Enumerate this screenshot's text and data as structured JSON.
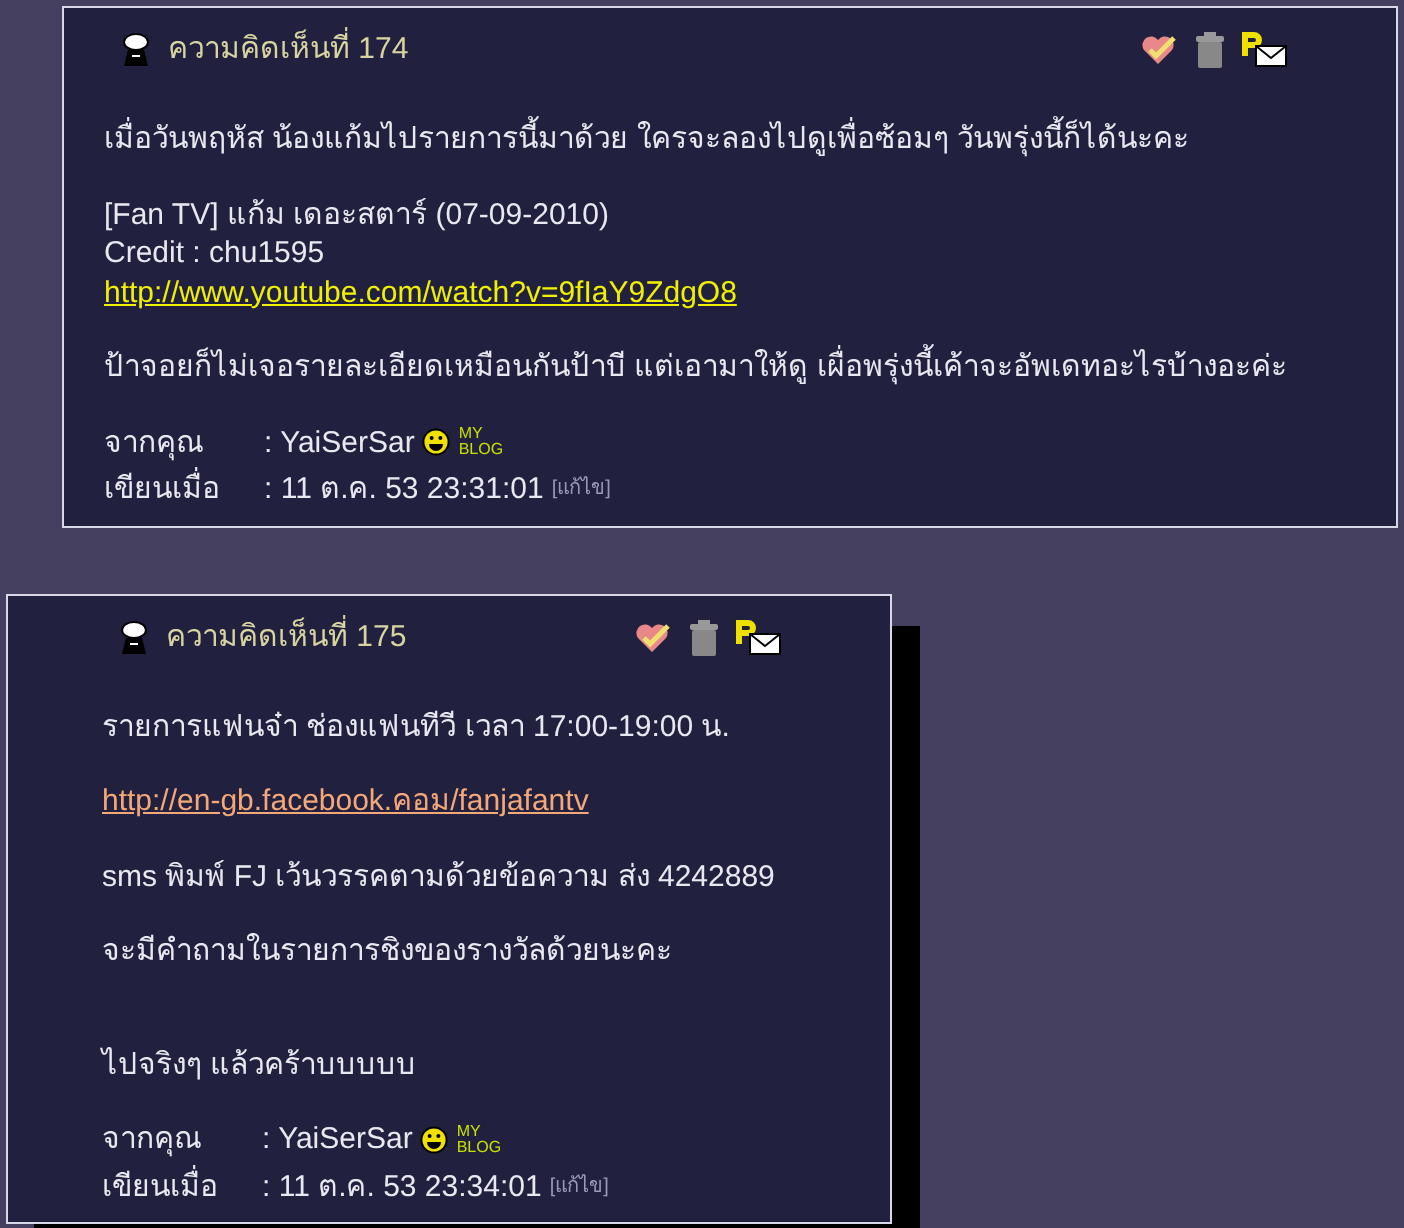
{
  "comments": [
    {
      "title": "ความคิดเห็นที่ 174",
      "paragraphs": [
        [
          {
            "kind": "text",
            "text": "เมื่อวันพฤหัส น้องแก้มไปรายการนี้มาด้วย ใครจะลองไปดูเพื่อซ้อมๆ วันพรุ่งนี้ก็ได้นะคะ"
          }
        ],
        [
          {
            "kind": "text",
            "text": "[Fan TV] แก้ม เดอะสตาร์ (07-09-2010)"
          },
          {
            "kind": "text",
            "text": "Credit : chu1595"
          },
          {
            "kind": "link",
            "visited": false,
            "text": "http://www.youtube.com/watch?v=9fIaY9ZdgO8"
          }
        ],
        [
          {
            "kind": "text",
            "text": "ป้าจอยก็ไม่เจอรายละเอียดเหมือนกันป้าบี แต่เอามาให้ดู เผื่อพรุ่งนี้เค้าจะอัพเดทอะไรบ้างอะค่ะ"
          }
        ]
      ],
      "from_label": "จากคุณ",
      "author": ": YaiSerSar",
      "blog_top": "MY",
      "blog_bottom": "BLOG",
      "date_label": "เขียนเมื่อ",
      "date": ": 11 ต.ค. 53 23:31:01",
      "edit": "[แก้ไข]"
    },
    {
      "title": "ความคิดเห็นที่ 175",
      "paragraphs": [
        [
          {
            "kind": "text",
            "text": "รายการแฟนจ๋า ช่องแฟนทีวี เวลา 17:00-19:00 น."
          }
        ],
        [
          {
            "kind": "link",
            "visited": true,
            "text": "http://en-gb.facebook.คอม/fanjafantv"
          }
        ],
        [
          {
            "kind": "text",
            "text": "sms พิมพ์ FJ เว้นวรรคตามด้วยข้อความ ส่ง 4242889"
          }
        ],
        [
          {
            "kind": "text",
            "text": "จะมีคำถามในรายการชิงของรางวัลด้วยนะคะ"
          }
        ],
        [
          {
            "kind": "text",
            "text": "ไปจริงๆ แล้วคร้าบบบบบ"
          }
        ]
      ],
      "from_label": "จากคุณ",
      "author": ": YaiSerSar",
      "blog_top": "MY",
      "blog_bottom": "BLOG",
      "date_label": "เขียนเมื่อ",
      "date": ": 11 ต.ค. 53 23:34:01",
      "edit": "[แก้ไข]"
    }
  ]
}
